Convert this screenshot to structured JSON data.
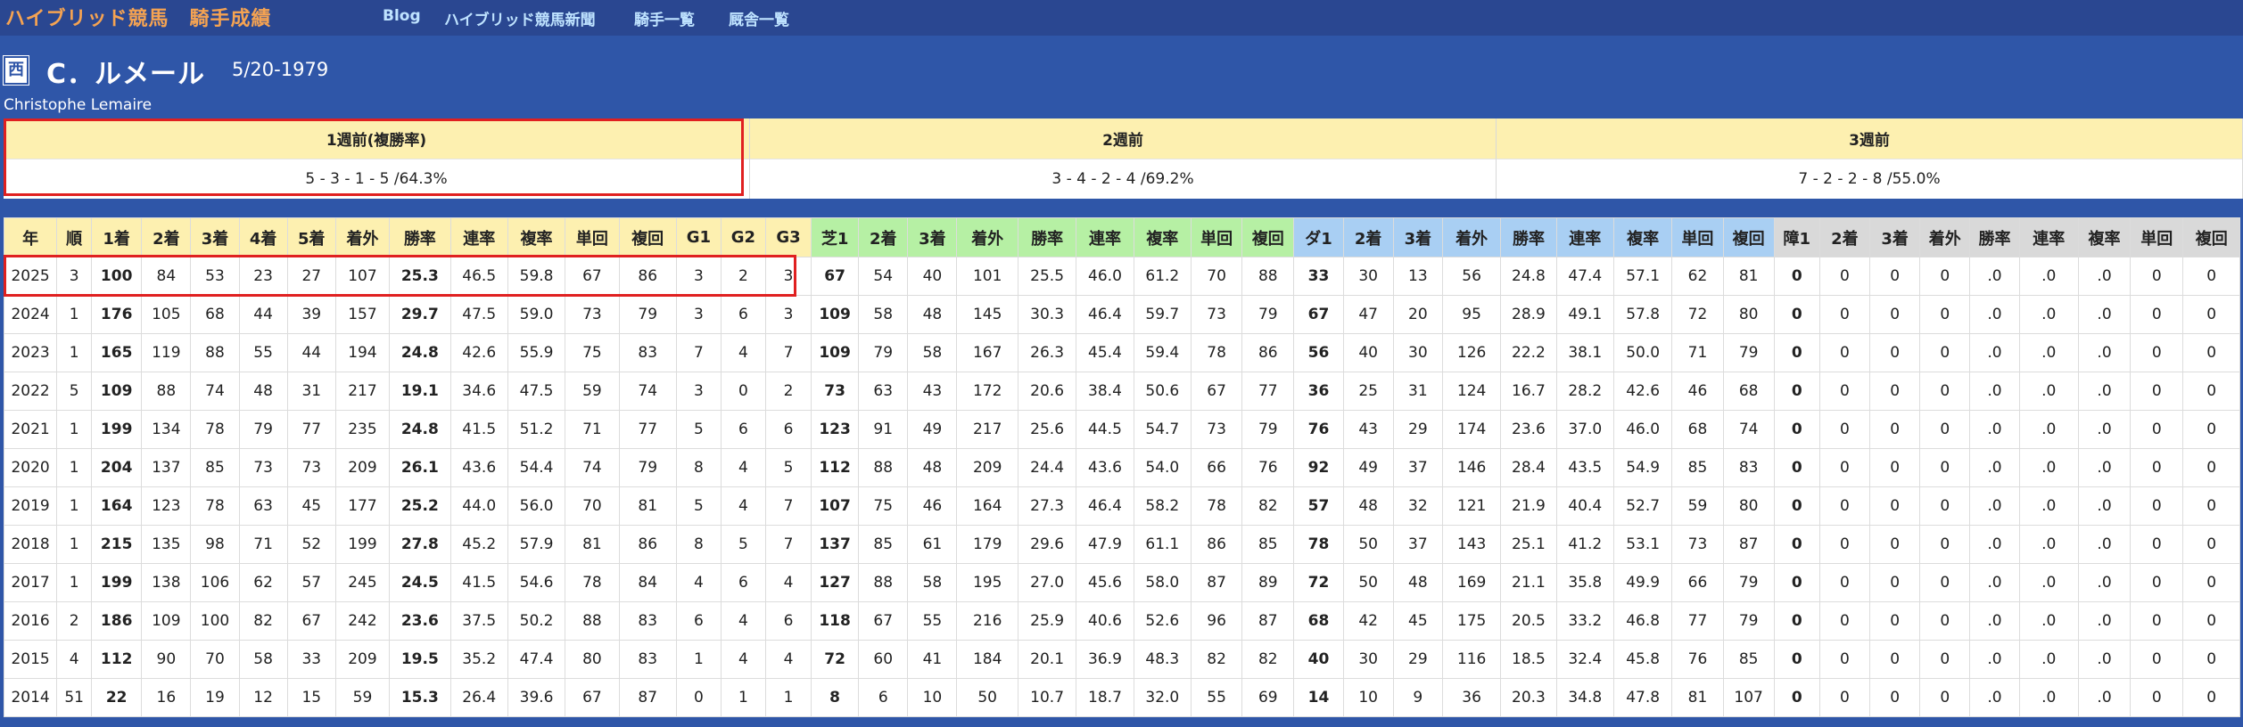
{
  "nav": {
    "site_title": "ハイブリッド競馬　騎手成績",
    "links": [
      "Blog",
      "ハイブリッド競馬新聞",
      "騎手一覧",
      "厩舎一覧"
    ]
  },
  "jockey": {
    "region": "西",
    "name": "C．ルメール",
    "birth": "5/20-1979",
    "name_roman": "Christophe Lemaire"
  },
  "weekly": {
    "headers": [
      "1週前(複勝率)",
      "2週前",
      "3週前"
    ],
    "values": [
      "5 - 3 - 1 - 5 /64.3%",
      "3 - 4 - 2 - 4 /69.2%",
      "7 - 2 - 2 - 8 /55.0%"
    ]
  },
  "table": {
    "headers": [
      "年",
      "順",
      "1着",
      "2着",
      "3着",
      "4着",
      "5着",
      "着外",
      "勝率",
      "連率",
      "複率",
      "単回",
      "複回",
      "G1",
      "G2",
      "G3",
      "芝1",
      "2着",
      "3着",
      "着外",
      "勝率",
      "連率",
      "複率",
      "単回",
      "複回",
      "ダ1",
      "2着",
      "3着",
      "着外",
      "勝率",
      "連率",
      "複率",
      "単回",
      "複回",
      "障1",
      "2着",
      "3着",
      "着外",
      "勝率",
      "連率",
      "複率",
      "単回",
      "複回"
    ],
    "rows": [
      [
        "2025",
        "3",
        "100",
        "84",
        "53",
        "23",
        "27",
        "107",
        "25.3",
        "46.5",
        "59.8",
        "67",
        "86",
        "3",
        "2",
        "3",
        "67",
        "54",
        "40",
        "101",
        "25.5",
        "46.0",
        "61.2",
        "70",
        "88",
        "33",
        "30",
        "13",
        "56",
        "24.8",
        "47.4",
        "57.1",
        "62",
        "81",
        "0",
        "0",
        "0",
        "0",
        ".0",
        ".0",
        ".0",
        "0",
        "0"
      ],
      [
        "2024",
        "1",
        "176",
        "105",
        "68",
        "44",
        "39",
        "157",
        "29.7",
        "47.5",
        "59.0",
        "73",
        "79",
        "3",
        "6",
        "3",
        "109",
        "58",
        "48",
        "145",
        "30.3",
        "46.4",
        "59.7",
        "73",
        "79",
        "67",
        "47",
        "20",
        "95",
        "28.9",
        "49.1",
        "57.8",
        "72",
        "80",
        "0",
        "0",
        "0",
        "0",
        ".0",
        ".0",
        ".0",
        "0",
        "0"
      ],
      [
        "2023",
        "1",
        "165",
        "119",
        "88",
        "55",
        "44",
        "194",
        "24.8",
        "42.6",
        "55.9",
        "75",
        "83",
        "7",
        "4",
        "7",
        "109",
        "79",
        "58",
        "167",
        "26.3",
        "45.4",
        "59.4",
        "78",
        "86",
        "56",
        "40",
        "30",
        "126",
        "22.2",
        "38.1",
        "50.0",
        "71",
        "79",
        "0",
        "0",
        "0",
        "0",
        ".0",
        ".0",
        ".0",
        "0",
        "0"
      ],
      [
        "2022",
        "5",
        "109",
        "88",
        "74",
        "48",
        "31",
        "217",
        "19.1",
        "34.6",
        "47.5",
        "59",
        "74",
        "3",
        "0",
        "2",
        "73",
        "63",
        "43",
        "172",
        "20.6",
        "38.4",
        "50.6",
        "67",
        "77",
        "36",
        "25",
        "31",
        "124",
        "16.7",
        "28.2",
        "42.6",
        "46",
        "68",
        "0",
        "0",
        "0",
        "0",
        ".0",
        ".0",
        ".0",
        "0",
        "0"
      ],
      [
        "2021",
        "1",
        "199",
        "134",
        "78",
        "79",
        "77",
        "235",
        "24.8",
        "41.5",
        "51.2",
        "71",
        "77",
        "5",
        "6",
        "6",
        "123",
        "91",
        "49",
        "217",
        "25.6",
        "44.5",
        "54.7",
        "73",
        "79",
        "76",
        "43",
        "29",
        "174",
        "23.6",
        "37.0",
        "46.0",
        "68",
        "74",
        "0",
        "0",
        "0",
        "0",
        ".0",
        ".0",
        ".0",
        "0",
        "0"
      ],
      [
        "2020",
        "1",
        "204",
        "137",
        "85",
        "73",
        "73",
        "209",
        "26.1",
        "43.6",
        "54.4",
        "74",
        "79",
        "8",
        "4",
        "5",
        "112",
        "88",
        "48",
        "209",
        "24.4",
        "43.6",
        "54.0",
        "66",
        "76",
        "92",
        "49",
        "37",
        "146",
        "28.4",
        "43.5",
        "54.9",
        "85",
        "83",
        "0",
        "0",
        "0",
        "0",
        ".0",
        ".0",
        ".0",
        "0",
        "0"
      ],
      [
        "2019",
        "1",
        "164",
        "123",
        "78",
        "63",
        "45",
        "177",
        "25.2",
        "44.0",
        "56.0",
        "70",
        "81",
        "5",
        "4",
        "7",
        "107",
        "75",
        "46",
        "164",
        "27.3",
        "46.4",
        "58.2",
        "78",
        "82",
        "57",
        "48",
        "32",
        "121",
        "21.9",
        "40.4",
        "52.7",
        "59",
        "80",
        "0",
        "0",
        "0",
        "0",
        ".0",
        ".0",
        ".0",
        "0",
        "0"
      ],
      [
        "2018",
        "1",
        "215",
        "135",
        "98",
        "71",
        "52",
        "199",
        "27.8",
        "45.2",
        "57.9",
        "81",
        "86",
        "8",
        "5",
        "7",
        "137",
        "85",
        "61",
        "179",
        "29.6",
        "47.9",
        "61.1",
        "86",
        "85",
        "78",
        "50",
        "37",
        "143",
        "25.1",
        "41.2",
        "53.1",
        "73",
        "87",
        "0",
        "0",
        "0",
        "0",
        ".0",
        ".0",
        ".0",
        "0",
        "0"
      ],
      [
        "2017",
        "1",
        "199",
        "138",
        "106",
        "62",
        "57",
        "245",
        "24.5",
        "41.5",
        "54.6",
        "78",
        "84",
        "4",
        "6",
        "4",
        "127",
        "88",
        "58",
        "195",
        "27.0",
        "45.6",
        "58.0",
        "87",
        "89",
        "72",
        "50",
        "48",
        "169",
        "21.1",
        "35.8",
        "49.9",
        "66",
        "79",
        "0",
        "0",
        "0",
        "0",
        ".0",
        ".0",
        ".0",
        "0",
        "0"
      ],
      [
        "2016",
        "2",
        "186",
        "109",
        "100",
        "82",
        "67",
        "242",
        "23.6",
        "37.5",
        "50.2",
        "88",
        "83",
        "6",
        "4",
        "6",
        "118",
        "67",
        "55",
        "216",
        "25.9",
        "40.6",
        "52.6",
        "96",
        "87",
        "68",
        "42",
        "45",
        "175",
        "20.5",
        "33.2",
        "46.8",
        "77",
        "79",
        "0",
        "0",
        "0",
        "0",
        ".0",
        ".0",
        ".0",
        "0",
        "0"
      ],
      [
        "2015",
        "4",
        "112",
        "90",
        "70",
        "58",
        "33",
        "209",
        "19.5",
        "35.2",
        "47.4",
        "80",
        "83",
        "1",
        "4",
        "4",
        "72",
        "60",
        "41",
        "184",
        "20.1",
        "36.9",
        "48.3",
        "82",
        "82",
        "40",
        "30",
        "29",
        "116",
        "18.5",
        "32.4",
        "45.8",
        "76",
        "85",
        "0",
        "0",
        "0",
        "0",
        ".0",
        ".0",
        ".0",
        "0",
        "0"
      ],
      [
        "2014",
        "51",
        "22",
        "16",
        "19",
        "12",
        "15",
        "59",
        "15.3",
        "26.4",
        "39.6",
        "67",
        "87",
        "0",
        "1",
        "1",
        "8",
        "6",
        "10",
        "50",
        "10.7",
        "18.7",
        "32.0",
        "55",
        "69",
        "14",
        "10",
        "9",
        "36",
        "20.3",
        "34.8",
        "47.8",
        "81",
        "107",
        "0",
        "0",
        "0",
        "0",
        ".0",
        ".0",
        ".0",
        "0",
        "0"
      ]
    ]
  },
  "colors": {
    "page_bg": "#2f56a8",
    "nav_bg": "#2a4791",
    "title": "#f5a352",
    "nav_link": "#bfe3ff",
    "header_main": "#fdf0b0",
    "header_turf": "#b6f0a4",
    "header_dirt": "#a9cff3",
    "header_jump": "#d9d9d9",
    "highlight": "#e02020"
  }
}
